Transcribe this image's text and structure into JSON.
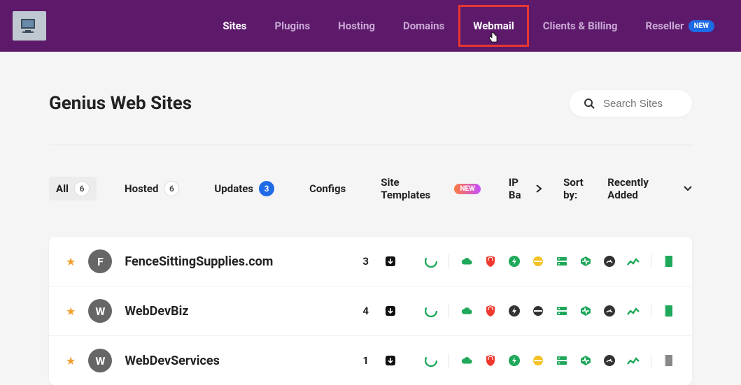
{
  "nav": {
    "items": [
      {
        "label": "Sites",
        "active": true
      },
      {
        "label": "Plugins"
      },
      {
        "label": "Hosting"
      },
      {
        "label": "Domains"
      },
      {
        "label": "Webmail",
        "highlighted": true
      },
      {
        "label": "Clients & Billing"
      },
      {
        "label": "Reseller",
        "badge": "NEW"
      }
    ]
  },
  "page": {
    "title": "Genius Web Sites",
    "search_placeholder": "Search Sites"
  },
  "filters": {
    "all": {
      "label": "All",
      "count": "6"
    },
    "hosted": {
      "label": "Hosted",
      "count": "6"
    },
    "updates": {
      "label": "Updates",
      "count": "3"
    },
    "configs": {
      "label": "Configs"
    },
    "templates": {
      "label": "Site Templates",
      "badge": "NEW"
    },
    "more": {
      "label": "IP Ba"
    }
  },
  "sort": {
    "label": "Sort by:",
    "value": "Recently Added"
  },
  "sites": [
    {
      "initial": "F",
      "name": "FenceSittingSupplies.com",
      "updates": "3"
    },
    {
      "initial": "W",
      "name": "WebDevBiz",
      "updates": "4"
    },
    {
      "initial": "W",
      "name": "WebDevServices",
      "updates": "1"
    }
  ],
  "colors": {
    "green": "#1fa85a",
    "red": "#f0382e",
    "yellow": "#f2c224",
    "dark": "#333333",
    "gray": "#888888"
  }
}
